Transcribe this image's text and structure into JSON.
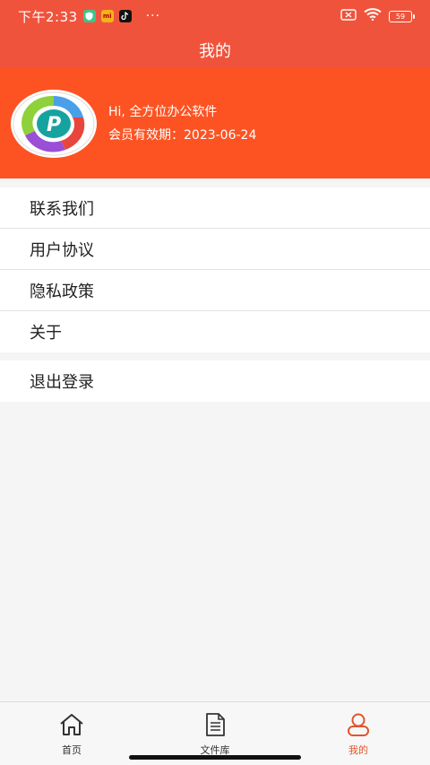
{
  "status_bar": {
    "time": "下午2:33",
    "app_badges": [
      "shield-app-icon",
      "mi",
      "tiktok-icon"
    ],
    "mi_label": "mi",
    "more": "···",
    "battery": "59"
  },
  "header": {
    "title": "我的"
  },
  "profile": {
    "greeting": "Hi, 全方位办公软件",
    "membership": "会员有效期：2023-06-24"
  },
  "menu": {
    "items": [
      {
        "label": "联系我们"
      },
      {
        "label": "用户协议"
      },
      {
        "label": "隐私政策"
      },
      {
        "label": "关于"
      }
    ],
    "logout": "退出登录"
  },
  "tabbar": {
    "tabs": [
      {
        "label": "首页",
        "icon": "home-icon"
      },
      {
        "label": "文件库",
        "icon": "document-icon"
      },
      {
        "label": "我的",
        "icon": "person-icon"
      }
    ],
    "active": "我的"
  },
  "colors": {
    "title_bar": "#f0533c",
    "profile_bg": "#fd5323",
    "active_tab": "#e2552a"
  }
}
